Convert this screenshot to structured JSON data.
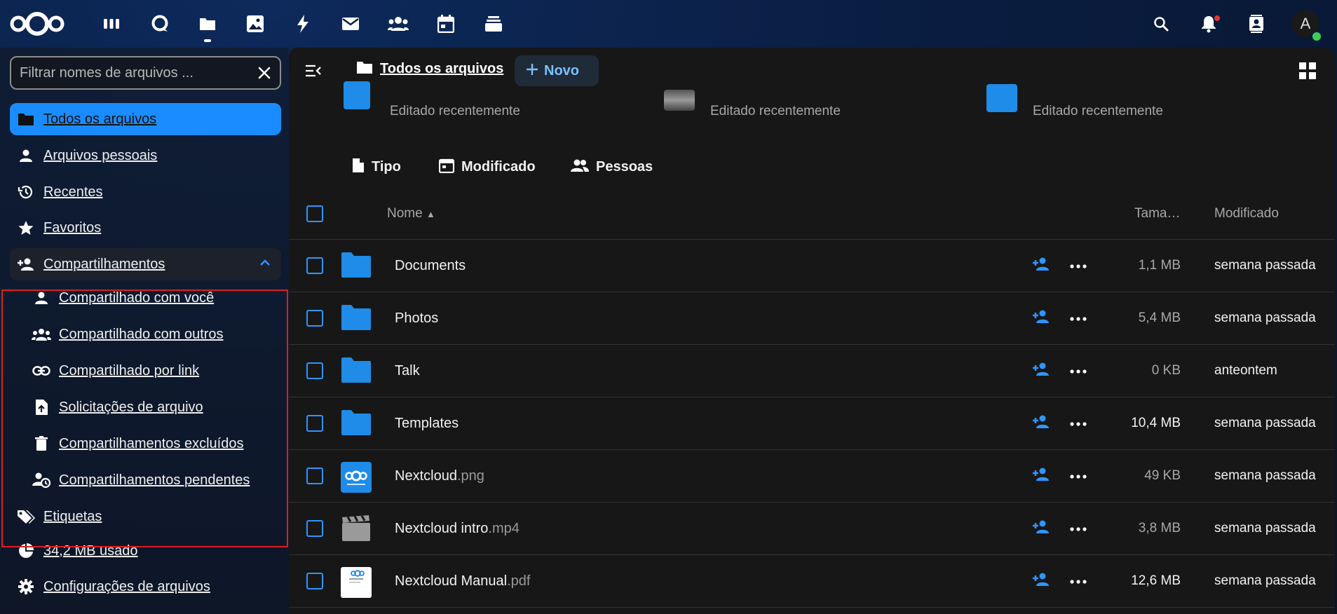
{
  "header": {
    "apps": [
      {
        "name": "dashboard-icon"
      },
      {
        "name": "talk-icon"
      },
      {
        "name": "files-icon"
      },
      {
        "name": "photos-icon"
      },
      {
        "name": "activity-icon"
      },
      {
        "name": "mail-icon"
      },
      {
        "name": "contacts-icon"
      },
      {
        "name": "calendar-icon"
      },
      {
        "name": "deck-icon"
      }
    ],
    "avatar_letter": "A"
  },
  "sidebar": {
    "filter_placeholder": "Filtrar nomes de arquivos ...",
    "items": [
      {
        "label": "Todos os arquivos",
        "icon": "folder-icon"
      },
      {
        "label": "Arquivos pessoais",
        "icon": "person-icon"
      },
      {
        "label": "Recentes",
        "icon": "history-icon"
      },
      {
        "label": "Favoritos",
        "icon": "star-icon"
      },
      {
        "label": "Compartilhamentos",
        "icon": "share-add-icon"
      },
      {
        "label": "Compartilhado com você",
        "icon": "person-icon"
      },
      {
        "label": "Compartilhado com outros",
        "icon": "group-icon"
      },
      {
        "label": "Compartilhado por link",
        "icon": "link-icon"
      },
      {
        "label": "Solicitações de arquivo",
        "icon": "file-upload-icon"
      },
      {
        "label": "Compartilhamentos excluídos",
        "icon": "trash-icon"
      },
      {
        "label": "Compartilhamentos pendentes",
        "icon": "account-clock-icon"
      },
      {
        "label": "Etiquetas",
        "icon": "tags-icon"
      },
      {
        "label": "34,2 MB usado",
        "icon": "pie-chart-icon"
      },
      {
        "label": "Configurações de arquivos",
        "icon": "gear-icon"
      }
    ]
  },
  "main": {
    "breadcrumb": "Todos os arquivos",
    "new_label": "Novo",
    "recent": [
      {
        "subtitle": "Editado recentemente"
      },
      {
        "subtitle": "Editado recentemente"
      },
      {
        "subtitle": "Editado recentemente"
      }
    ],
    "filters": {
      "type": "Tipo",
      "modified": "Modificado",
      "people": "Pessoas"
    },
    "columns": {
      "name": "Nome",
      "size": "Tama…",
      "modified": "Modificado"
    },
    "files": [
      {
        "name": "Documents",
        "ext": "",
        "size": "1,1 MB",
        "modified": "semana passada",
        "kind": "folder"
      },
      {
        "name": "Photos",
        "ext": "",
        "size": "5,4 MB",
        "modified": "semana passada",
        "kind": "folder"
      },
      {
        "name": "Talk",
        "ext": "",
        "size": "0 KB",
        "modified": "anteontem",
        "kind": "folder"
      },
      {
        "name": "Templates",
        "ext": "",
        "size": "10,4 MB",
        "modified": "semana passada",
        "kind": "folder"
      },
      {
        "name": "Nextcloud",
        "ext": ".png",
        "size": "49 KB",
        "modified": "semana passada",
        "kind": "image"
      },
      {
        "name": "Nextcloud intro",
        "ext": ".mp4",
        "size": "3,8 MB",
        "modified": "semana passada",
        "kind": "video"
      },
      {
        "name": "Nextcloud Manual",
        "ext": ".pdf",
        "size": "12,6 MB",
        "modified": "semana passada",
        "kind": "pdf"
      }
    ]
  },
  "colors": {
    "accent": "#1a8cff",
    "folder": "#1e8ce8",
    "highlight": "#e11d1d"
  }
}
